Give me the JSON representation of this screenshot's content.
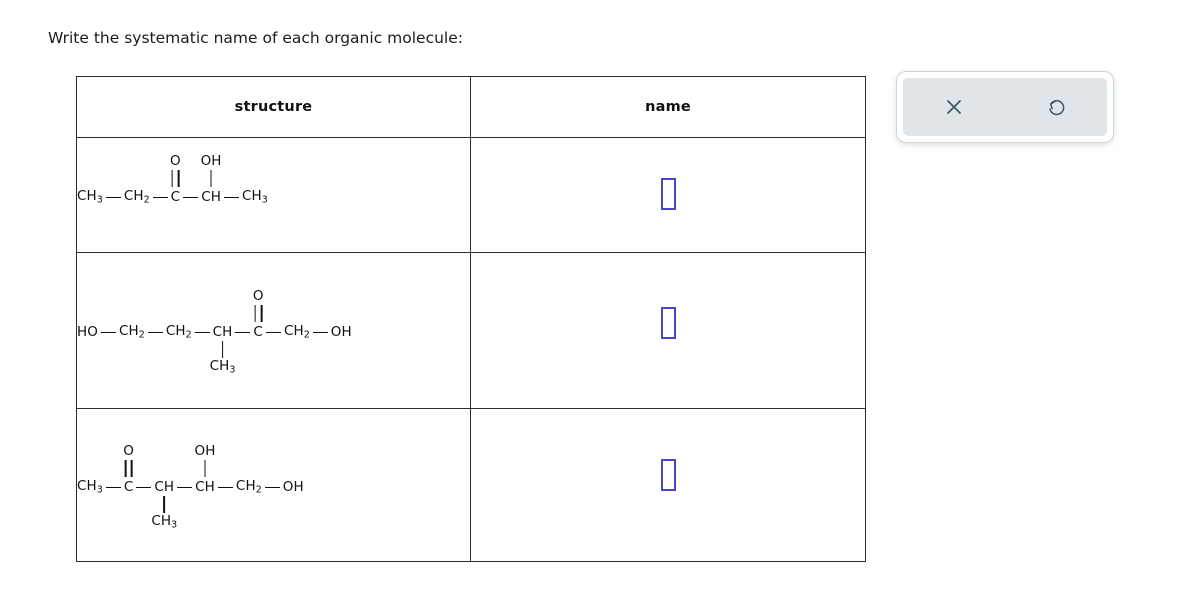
{
  "prompt": "Write the systematic name of each organic molecule:",
  "table": {
    "headers": {
      "structure": "structure",
      "name": "name"
    },
    "rows": [
      {
        "id": "row-1",
        "structure_text": "CH3 — CH2 — C(=O) — CH(OH) — CH3",
        "answer_value": "",
        "answer_placeholder": ""
      },
      {
        "id": "row-2",
        "structure_text": "HO — CH2 — CH2 — CH(CH3) — C(=O) — CH2 — OH",
        "answer_value": "",
        "answer_placeholder": ""
      },
      {
        "id": "row-3",
        "structure_text": "CH3 — C(=O) — CH(CH3) — CH(OH) — CH2 — OH",
        "answer_value": "",
        "answer_placeholder": ""
      }
    ]
  },
  "molecules": {
    "m1": {
      "chain": [
        {
          "label": "CH",
          "sub": "3"
        },
        {
          "label": "CH",
          "sub": "2"
        },
        {
          "label": "C",
          "sub": "",
          "up": "O",
          "up_bond": "double"
        },
        {
          "label": "CH",
          "sub": "",
          "up": "OH",
          "up_bond": "single"
        },
        {
          "label": "CH",
          "sub": "3"
        }
      ]
    },
    "m2": {
      "chain": [
        {
          "label": "HO",
          "sub": ""
        },
        {
          "label": "CH",
          "sub": "2"
        },
        {
          "label": "CH",
          "sub": "2"
        },
        {
          "label": "CH",
          "sub": "",
          "down": "CH",
          "down_sub": "3",
          "down_bond": "single"
        },
        {
          "label": "C",
          "sub": "",
          "up": "O",
          "up_bond": "double"
        },
        {
          "label": "CH",
          "sub": "2"
        },
        {
          "label": "OH",
          "sub": ""
        }
      ]
    },
    "m3": {
      "chain": [
        {
          "label": "CH",
          "sub": "3"
        },
        {
          "label": "C",
          "sub": "",
          "up": "O",
          "up_bond": "double"
        },
        {
          "label": "CH",
          "sub": "",
          "down": "CH",
          "down_sub": "3",
          "down_bond": "single"
        },
        {
          "label": "CH",
          "sub": "",
          "up": "OH",
          "up_bond": "single"
        },
        {
          "label": "CH",
          "sub": "2"
        },
        {
          "label": "OH",
          "sub": ""
        }
      ]
    }
  },
  "tool_palette": {
    "clear_icon": "close-x-icon",
    "clear_label": "",
    "reset_icon": "undo-reset-icon",
    "reset_label": ""
  },
  "colors": {
    "input_border": "#4a46c8",
    "table_border": "#2b2b2b",
    "palette_bg": "#dfe5e8",
    "palette_icon": "#3f5560",
    "text": "#1a1a1a"
  }
}
